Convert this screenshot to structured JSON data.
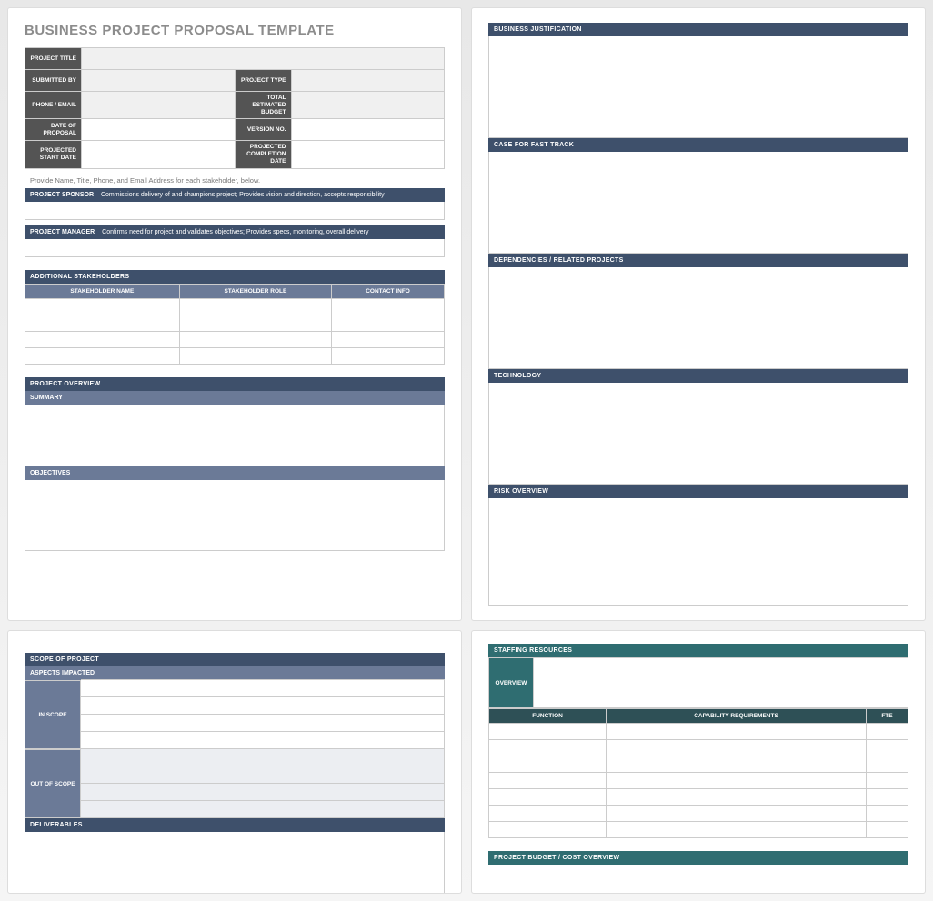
{
  "title": "BUSINESS PROJECT PROPOSAL TEMPLATE",
  "meta": {
    "project_title": "PROJECT TITLE",
    "submitted_by": "SUBMITTED BY",
    "project_type": "PROJECT TYPE",
    "phone_email": "PHONE / EMAIL",
    "total_budget": "TOTAL\nESTIMATED BUDGET",
    "date_proposal": "DATE OF\nPROPOSAL",
    "version_no": "VERSION NO.",
    "start_date": "PROJECTED\nSTART DATE",
    "completion_date": "PROJECTED\nCOMPLETION DATE"
  },
  "note": "Provide Name, Title, Phone, and Email Address for each stakeholder, below.",
  "sponsor_label": "PROJECT SPONSOR",
  "sponsor_desc": "Commissions delivery of and champions project; Provides vision and direction, accepts responsibility",
  "manager_label": "PROJECT MANAGER",
  "manager_desc": "Confirms need for project and validates objectives; Provides specs, monitoring, overall delivery",
  "stakeholders": {
    "header": "ADDITIONAL STAKEHOLDERS",
    "cols": {
      "name": "STAKEHOLDER NAME",
      "role": "STAKEHOLDER ROLE",
      "contact": "CONTACT INFO"
    }
  },
  "overview": {
    "header": "PROJECT OVERVIEW",
    "summary": "SUMMARY",
    "objectives": "OBJECTIVES"
  },
  "sections": {
    "justification": "BUSINESS JUSTIFICATION",
    "fasttrack": "CASE FOR FAST TRACK",
    "dependencies": "DEPENDENCIES / RELATED PROJECTS",
    "technology": "TECHNOLOGY",
    "risk": "RISK OVERVIEW"
  },
  "scope": {
    "header": "SCOPE OF PROJECT",
    "aspects": "ASPECTS IMPACTED",
    "in": "IN SCOPE",
    "out": "OUT OF SCOPE",
    "deliverables": "DELIVERABLES"
  },
  "staffing": {
    "header": "STAFFING RESOURCES",
    "overview": "OVERVIEW",
    "cols": {
      "function": "FUNCTION",
      "capability": "CAPABILITY REQUIREMENTS",
      "fte": "FTE"
    },
    "budget": "PROJECT BUDGET / COST OVERVIEW"
  }
}
